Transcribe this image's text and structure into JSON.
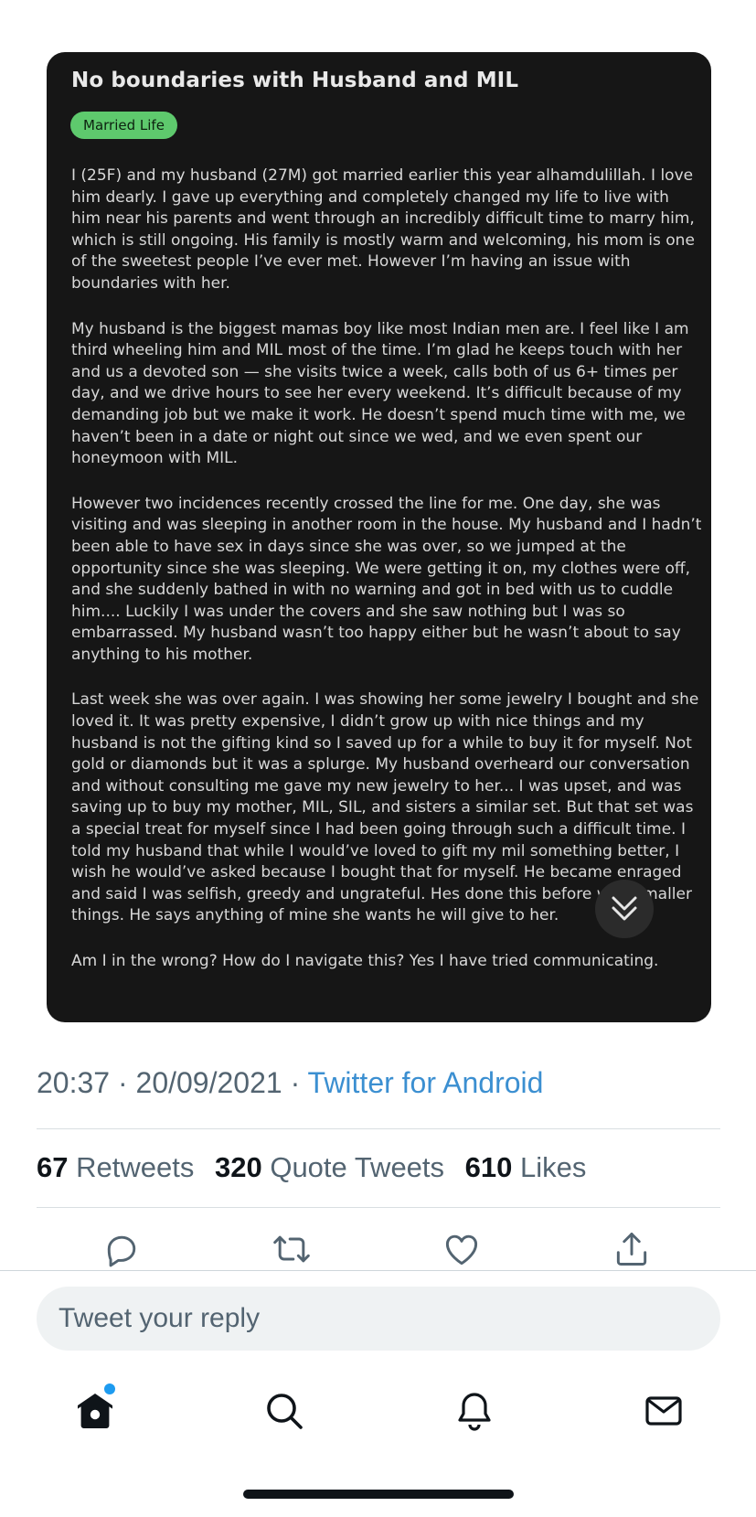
{
  "post": {
    "title": "No boundaries with Husband and MIL",
    "tag": "Married Life",
    "tag_color": "#5ec96d",
    "paragraphs": [
      "I (25F) and my husband (27M) got married earlier this year alhamdulillah. I love him dearly. I gave up everything and completely changed my life to live with him near his parents and went through an incredibly difficult time to marry him, which is still ongoing. His family is mostly warm and welcoming, his mom is one of the sweetest people I’ve ever met. However I’m having an issue with boundaries with her.",
      "My husband is the biggest mamas boy like most Indian men are. I feel like I am third wheeling him and MIL most of the time. I’m glad he keeps touch with her and us a devoted son — she visits twice a week, calls both of us 6+ times per day, and we drive hours to see her every weekend. It’s difficult because of my demanding job but we make it work. He doesn’t spend much time with me, we haven’t been in a date or night out since we wed, and we even spent our honeymoon with MIL.",
      "However two incidences recently crossed the line for me. One day, she was visiting and was sleeping in another room in the house. My husband and I hadn’t been able to have sex in days since she was over, so we jumped at the opportunity since she was sleeping. We were getting it on, my clothes were off, and she suddenly bathed in with no warning and got in bed with us to cuddle him.... Luckily I was under the covers and she saw nothing but I was so embarrassed. My husband wasn’t too happy either but he wasn’t about to say anything to his mother.",
      "Last week she was over again. I was showing her some jewelry I bought and she loved it. It was pretty expensive, I didn’t grow up with nice things and my husband is not the gifting kind so I saved up for a while to buy it for myself. Not gold or diamonds but it was a splurge. My husband overheard our conversation and without consulting me gave my new jewelry to her... I was upset, and was saving up to buy my mother, MIL, SIL, and sisters a similar set. But that set was a special treat for myself since I had been going through such a difficult time. I told my husband that while I would’ve loved to gift my mil something better, I wish he would’ve asked because I bought that for myself. He became enraged and said I was selfish, greedy and ungrateful. Hes done this before with smaller things. He says anything of mine she wants he will give to her.",
      "Am I in the wrong? How do I navigate this? Yes I have tried communicating."
    ]
  },
  "tweet": {
    "time": "20:37",
    "date": "20/09/2021",
    "separator": "·",
    "source": "Twitter for Android",
    "source_color": "#3b8fd1",
    "stats": [
      {
        "count": "67",
        "label": "Retweets"
      },
      {
        "count": "320",
        "label": "Quote Tweets"
      },
      {
        "count": "610",
        "label": "Likes"
      }
    ],
    "actions": [
      "reply-icon",
      "retweet-icon",
      "like-icon",
      "share-icon"
    ]
  },
  "reply": {
    "placeholder": "Tweet your reply"
  },
  "tabbar": {
    "items": [
      "home-icon",
      "search-icon",
      "notifications-icon",
      "messages-icon"
    ],
    "badge_color": "#1d9bf0"
  }
}
